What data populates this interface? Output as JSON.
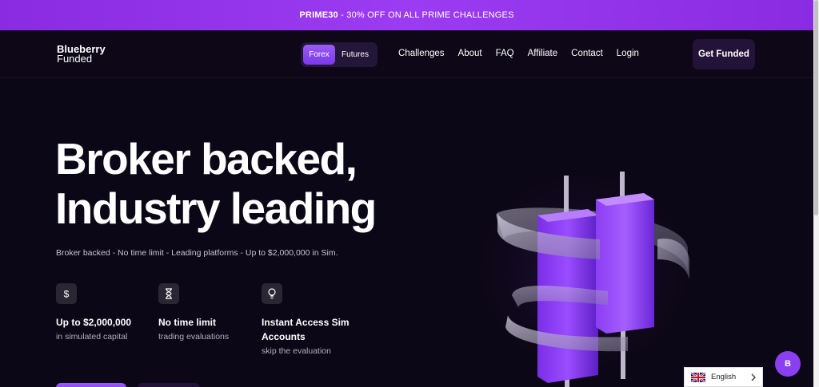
{
  "promo": {
    "code": "PRIME30",
    "text": " - 30% OFF ON ALL PRIME CHALLENGES"
  },
  "brand": {
    "line1": "Blueberry",
    "line2": "Funded"
  },
  "market_toggle": {
    "options": [
      "Forex",
      "Futures"
    ],
    "selected": "Forex"
  },
  "nav": {
    "links": [
      "Challenges",
      "About",
      "FAQ",
      "Affiliate",
      "Contact",
      "Login"
    ],
    "cta": "Get Funded"
  },
  "hero": {
    "title_line1": "Broker backed,",
    "title_line2": "Industry leading",
    "subtitle": "Broker backed - No time limit - Leading platforms - Up to $2,000,000 in Sim."
  },
  "features": [
    {
      "icon": "dollar-icon",
      "title": "Up to $2,000,000",
      "subtitle": "in simulated capital"
    },
    {
      "icon": "hourglass-icon",
      "title": "No time limit",
      "subtitle": "trading evaluations"
    },
    {
      "icon": "lightbulb-icon",
      "title_line1": "Instant Access Sim",
      "title_line2": "Accounts",
      "subtitle": "skip the evaluation"
    }
  ],
  "chat": {
    "label": "B"
  },
  "language": {
    "selected": "English",
    "icon": "uk-flag-icon"
  },
  "colors": {
    "accent": "#8a3ff0",
    "background": "#0c0716",
    "promo": "#9b3cf2"
  }
}
